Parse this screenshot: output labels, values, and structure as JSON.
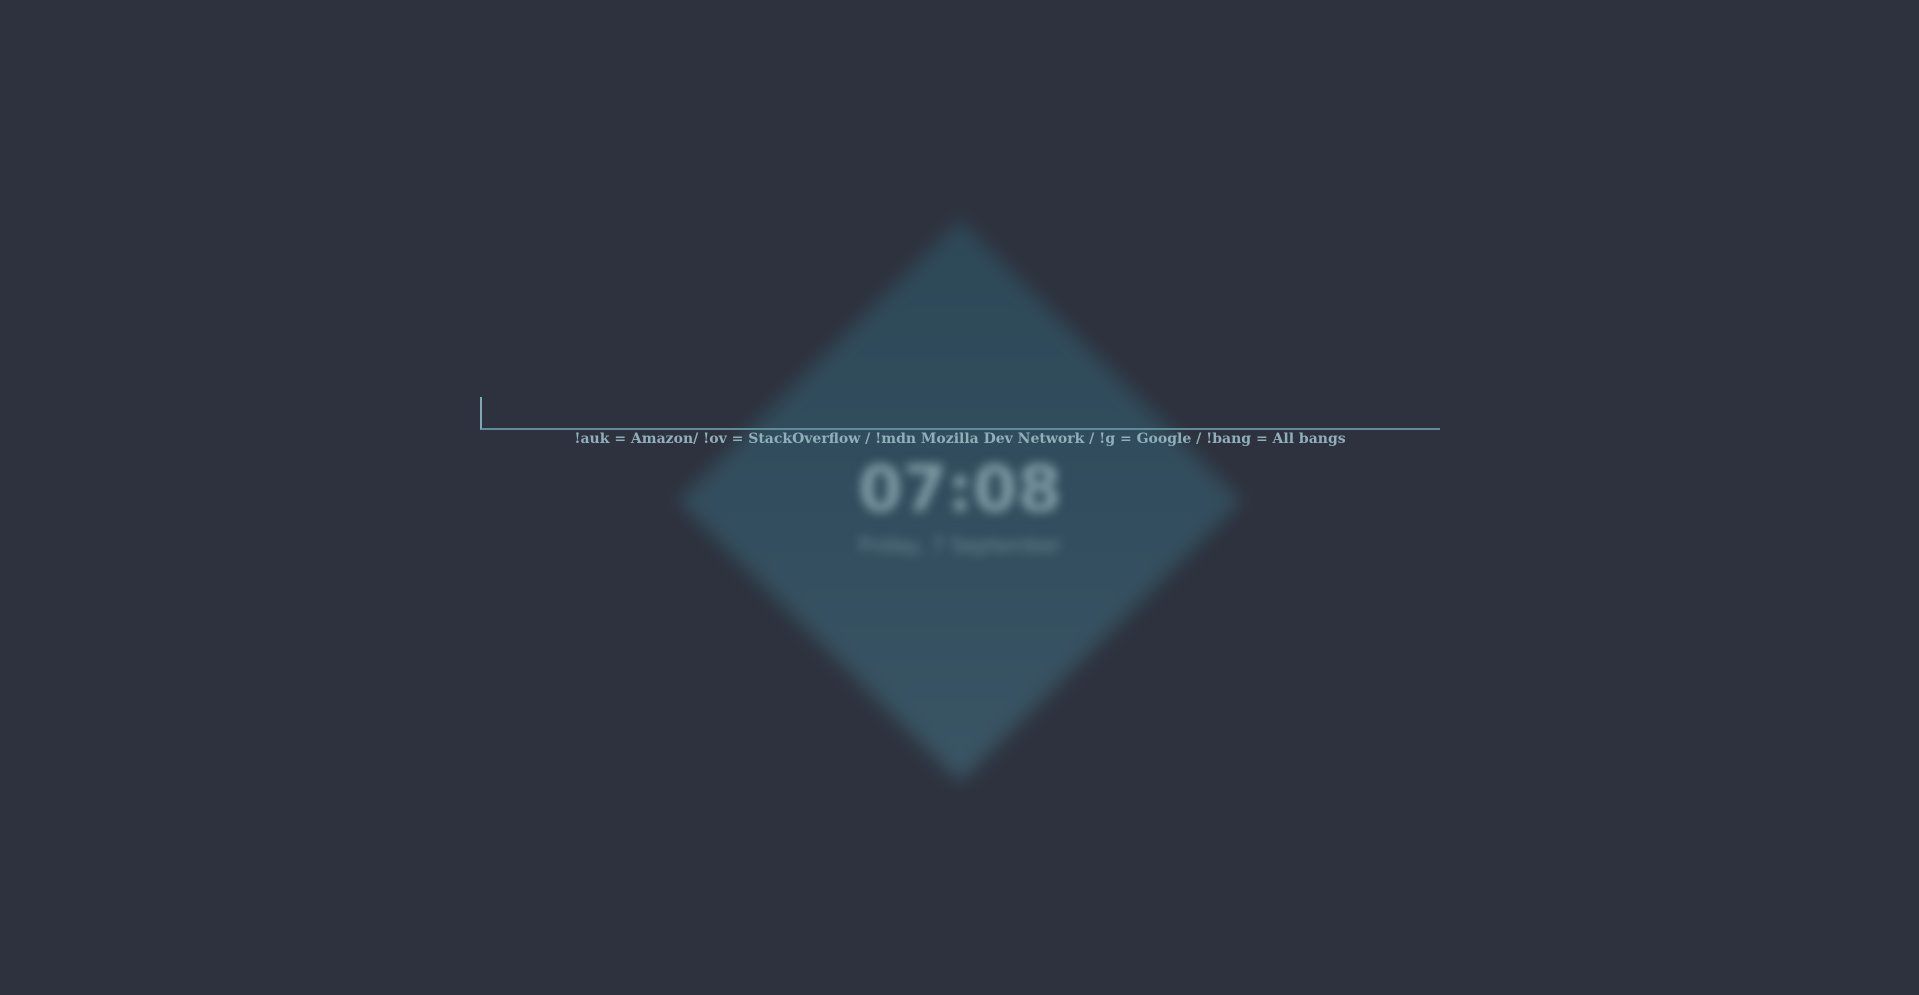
{
  "search": {
    "value": "",
    "placeholder": ""
  },
  "hint": "!auk = Amazon/ !ov = StackOverflow / !mdn Mozilla Dev Network / !g = Google / !bang = All bangs",
  "clock": {
    "time": "07:08",
    "date": "Friday, 7 September"
  },
  "colors": {
    "background": "#2e323e",
    "accent": "#7fa8b5",
    "diamond": "#345060"
  }
}
